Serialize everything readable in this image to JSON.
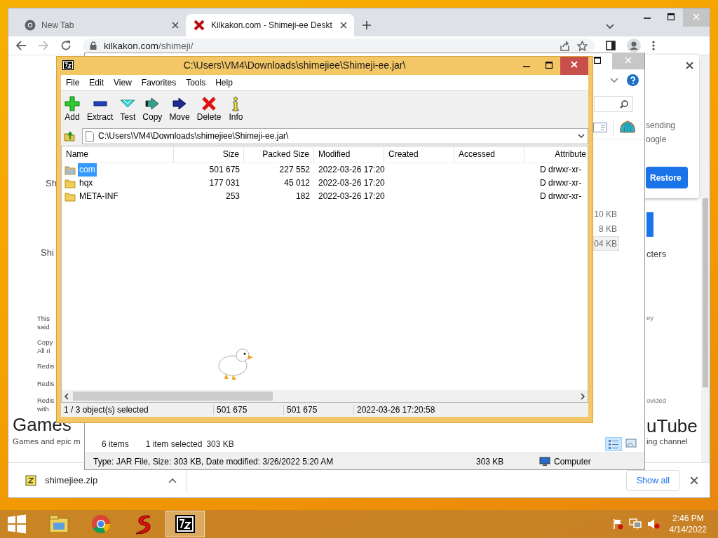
{
  "browser": {
    "tabs": [
      {
        "title": "New Tab",
        "selected": false
      },
      {
        "title": "Kilkakon.com - Shimeji-ee Deskt",
        "selected": true
      }
    ],
    "address": {
      "host": "kilkakon.com",
      "path": "/shimeji/"
    },
    "page_left": [
      "Sh",
      "Shi",
      "This",
      "said",
      "Copy",
      "All ri",
      "Redis",
      "Redis",
      "Redis",
      "with"
    ],
    "page_left_heading": "Games",
    "page_left_subheading": "Games and epic m",
    "page_right": [
      "cters",
      "ey",
      "ovided"
    ],
    "page_right_heading": "uTube",
    "page_right_subheading": "ing channel",
    "popup": {
      "lines": [
        "sending",
        "oogle"
      ],
      "button": "Restore"
    },
    "downloads": {
      "file": "shimejiee.zip",
      "show_all": "Show all"
    }
  },
  "explorer": {
    "sizes": [
      {
        "text": "10 KB",
        "selected": false
      },
      {
        "text": "8 KB",
        "selected": false
      },
      {
        "text": "04 KB",
        "selected": true
      }
    ],
    "status": {
      "count": "6 items",
      "selection": "1 item selected",
      "selection_size": "303 KB"
    },
    "details": {
      "summary": "Type: JAR File, Size: 303 KB, Date modified: 3/26/2022 5:20 AM",
      "size": "303 KB",
      "location": "Computer"
    }
  },
  "archive": {
    "title": "C:\\Users\\VM4\\Downloads\\shimejiee\\Shimeji-ee.jar\\",
    "menu": [
      "File",
      "Edit",
      "View",
      "Favorites",
      "Tools",
      "Help"
    ],
    "toolbar": [
      {
        "kind": "add",
        "label": "Add"
      },
      {
        "kind": "extract",
        "label": "Extract"
      },
      {
        "kind": "test",
        "label": "Test"
      },
      {
        "kind": "copy",
        "label": "Copy"
      },
      {
        "kind": "move",
        "label": "Move"
      },
      {
        "kind": "delete",
        "label": "Delete"
      },
      {
        "kind": "info",
        "label": "Info"
      }
    ],
    "path": "C:\\Users\\VM4\\Downloads\\shimejiee\\Shimeji-ee.jar\\",
    "columns": [
      "Name",
      "Size",
      "Packed Size",
      "Modified",
      "Created",
      "Accessed",
      "Attribute"
    ],
    "rows": [
      {
        "name": "com",
        "size": "501 675",
        "packed_size": "227 552",
        "modified": "2022-03-26 17:20",
        "attributes": "D drwxr-xr-",
        "selected": true
      },
      {
        "name": "hqx",
        "size": "177 031",
        "packed_size": "45 012",
        "modified": "2022-03-26 17:20",
        "attributes": "D drwxr-xr-",
        "selected": false
      },
      {
        "name": "META-INF",
        "size": "253",
        "packed_size": "182",
        "modified": "2022-03-26 17:20",
        "attributes": "D drwxr-xr-",
        "selected": false
      }
    ],
    "status": [
      "1 / 3 object(s) selected",
      "501 675",
      "501 675",
      "2022-03-26 17:20:58"
    ]
  },
  "taskbar": {
    "apps": [
      {
        "kind": "files",
        "selected": false
      },
      {
        "kind": "chrome",
        "selected": false
      },
      {
        "kind": "s-app",
        "selected": false
      },
      {
        "kind": "archiver",
        "selected": true
      }
    ],
    "time": "2:46 PM",
    "date": "4/14/2022"
  }
}
